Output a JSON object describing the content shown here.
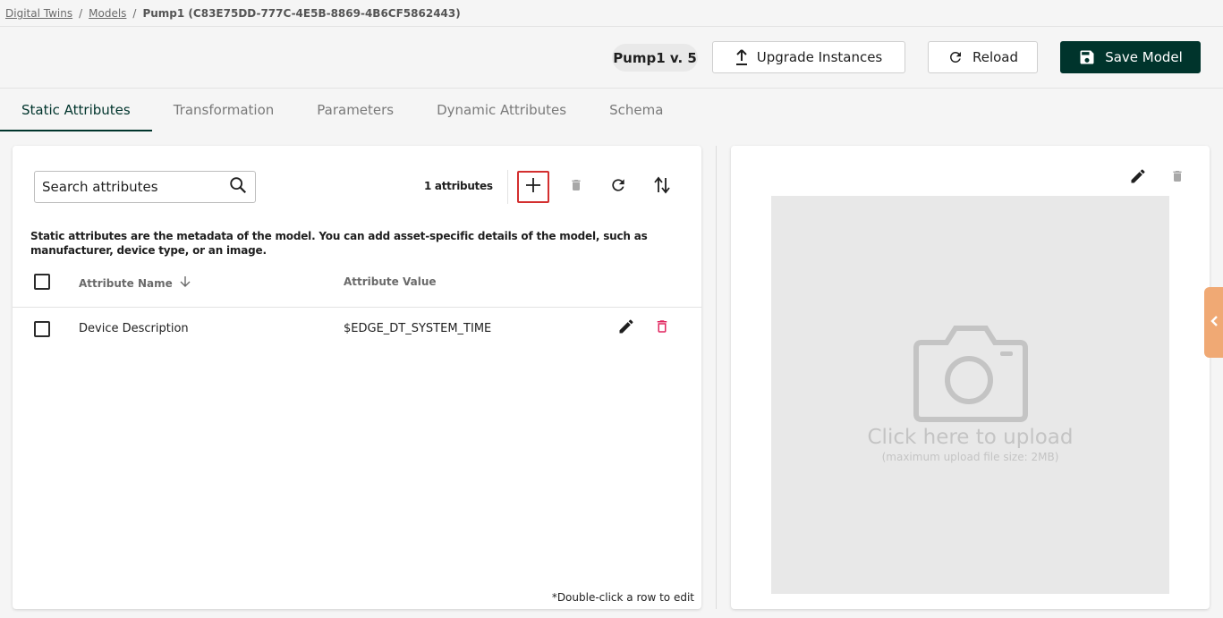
{
  "breadcrumb": {
    "items": [
      "Digital Twins",
      "Models"
    ],
    "separator": "/",
    "current": "Pump1 (C83E75DD-777C-4E5B-8869-4B6CF5862443)"
  },
  "header": {
    "version_chip": "Pump1 v. 5",
    "upgrade_label": "Upgrade Instances",
    "reload_label": "Reload",
    "save_label": "Save Model"
  },
  "tabs": [
    {
      "label": "Static Attributes",
      "active": true
    },
    {
      "label": "Transformation",
      "active": false
    },
    {
      "label": "Parameters",
      "active": false
    },
    {
      "label": "Dynamic Attributes",
      "active": false
    },
    {
      "label": "Schema",
      "active": false
    }
  ],
  "attributes_panel": {
    "search_placeholder": "Search attributes",
    "count_label": "1 attributes",
    "description": "Static attributes are the metadata of the model. You can add asset-specific details of the model, such as manufacturer, device type, or an image.",
    "columns": {
      "name": "Attribute Name",
      "value": "Attribute Value"
    },
    "rows": [
      {
        "name": "Device Description",
        "value": "$EDGE_DT_SYSTEM_TIME"
      }
    ],
    "footer_note": "*Double-click a row to edit"
  },
  "image_panel": {
    "upload_text": "Click here to upload",
    "upload_hint": "(maximum upload file size: 2MB)"
  },
  "colors": {
    "primary": "#00342c",
    "accent_red": "#d32f2f",
    "delete_red": "#e0245e",
    "handle": "#f0a974"
  }
}
